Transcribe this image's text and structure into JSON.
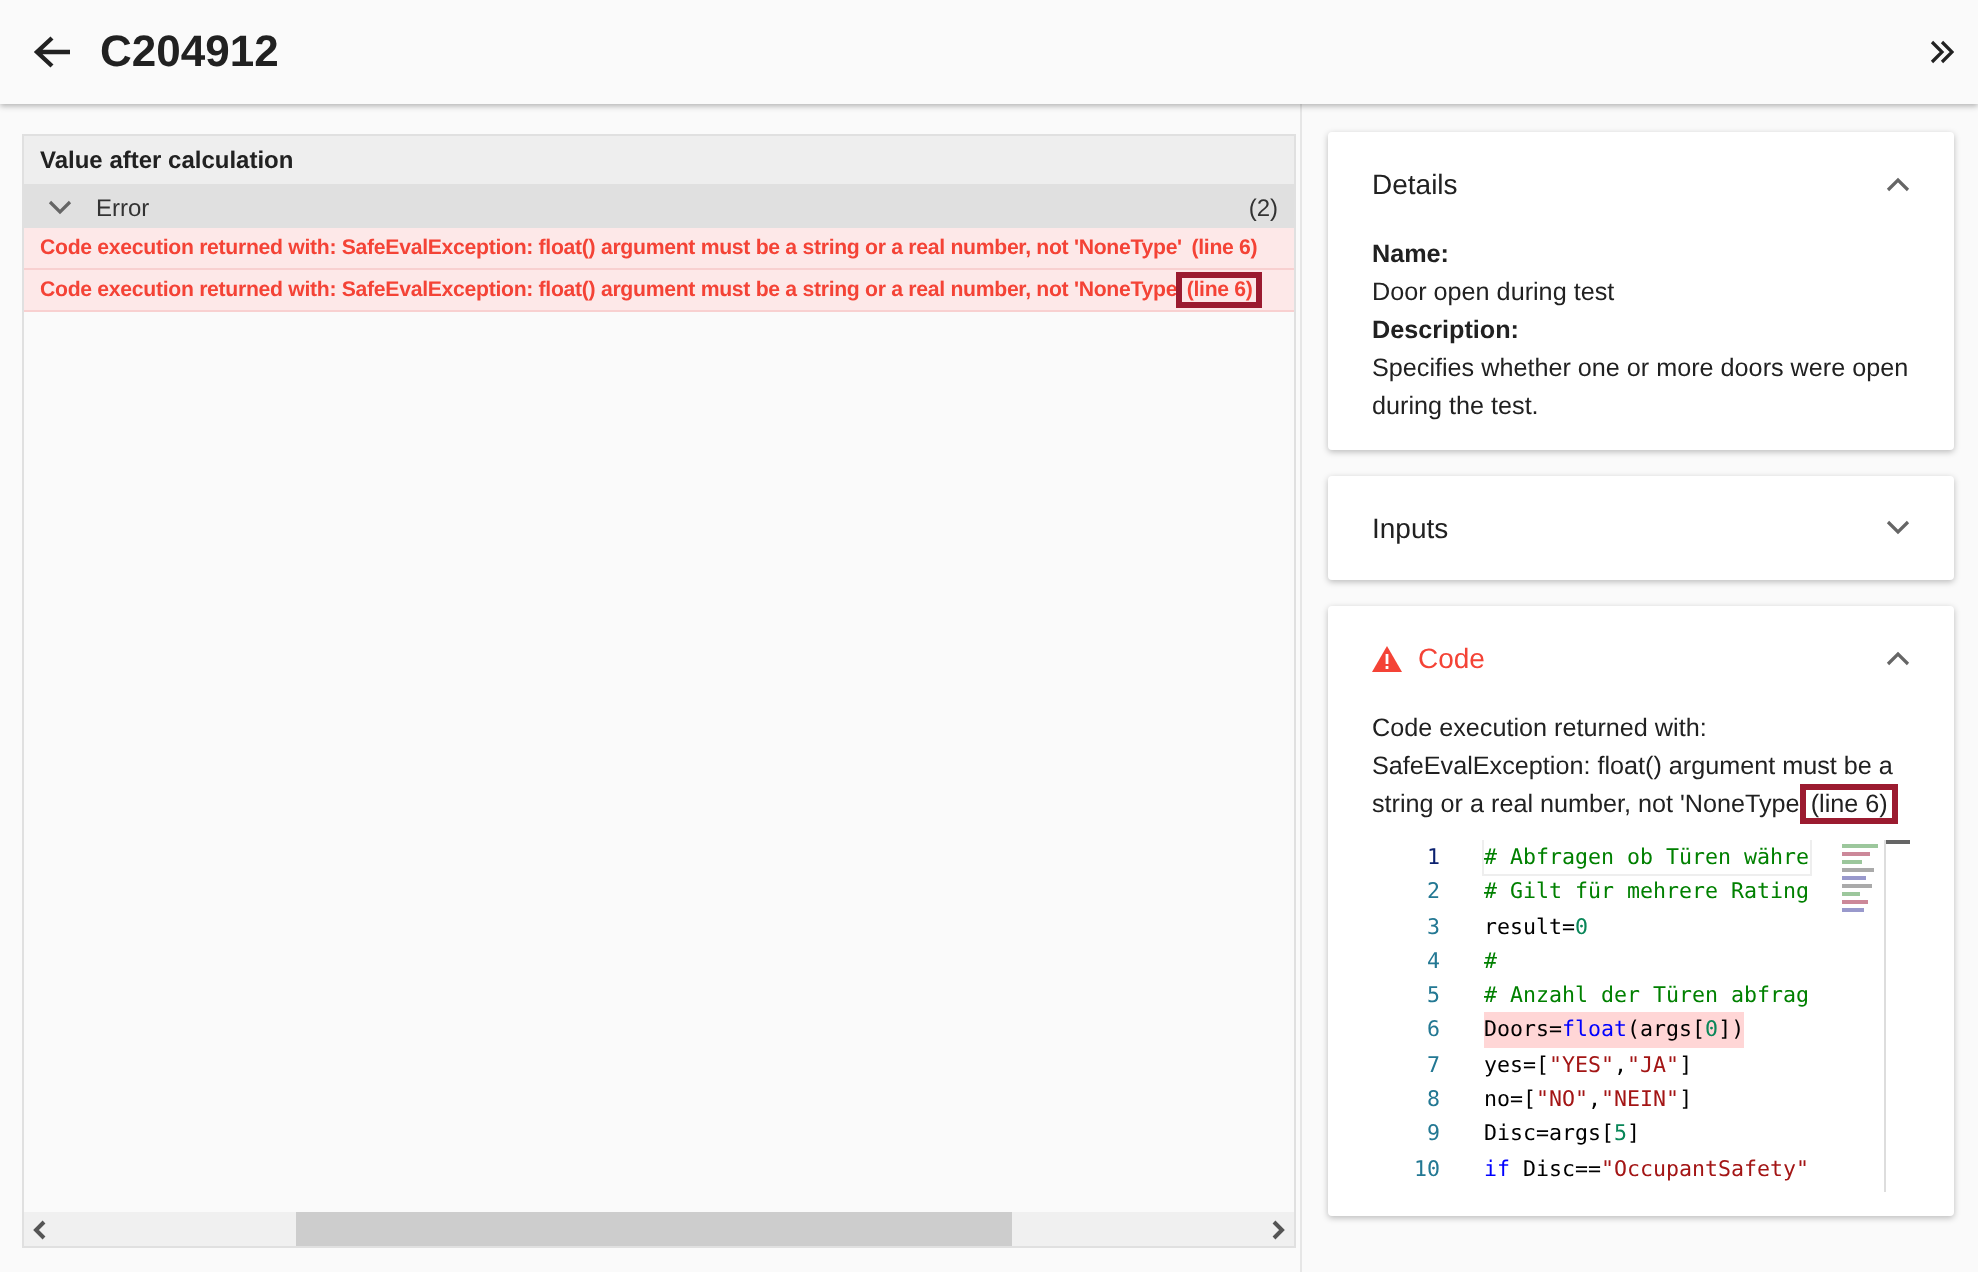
{
  "header": {
    "title": "C204912"
  },
  "result_panel": {
    "title": "Value after calculation",
    "group": {
      "label": "Error",
      "count": "(2)",
      "expanded": true
    },
    "rows": [
      {
        "message": "Code execution returned with: SafeEvalException: float() argument must be a string or a real number, not 'NoneType'",
        "line": "(line 6)",
        "marked": false
      },
      {
        "message": "Code execution returned with: SafeEvalException: float() argument must be a string or a real number, not 'NoneType",
        "line": "(line 6)",
        "marked": true
      }
    ]
  },
  "details": {
    "title": "Details",
    "expanded": true,
    "fields": [
      {
        "label": "Name:",
        "value": "Door open during test"
      },
      {
        "label": "Description:",
        "value": "Specifies whether one or more doors were open during the test."
      }
    ]
  },
  "inputs": {
    "title": "Inputs",
    "expanded": false
  },
  "code": {
    "title": "Code",
    "expanded": true,
    "error": true,
    "message": "Code execution returned with: SafeEvalException: float() argument must be a string or a real number, not 'NoneType",
    "line": "(line 6)",
    "marked": true,
    "lines": [
      {
        "number": "1",
        "current": true,
        "error": false,
        "tokens": [
          {
            "kind": "comment",
            "text": "# Abfragen ob Türen währe"
          }
        ]
      },
      {
        "number": "2",
        "current": false,
        "error": false,
        "tokens": [
          {
            "kind": "comment",
            "text": "# Gilt für mehrere Rating"
          }
        ]
      },
      {
        "number": "3",
        "current": false,
        "error": false,
        "tokens": [
          {
            "kind": "plain",
            "text": "result="
          },
          {
            "kind": "number",
            "text": "0"
          }
        ]
      },
      {
        "number": "4",
        "current": false,
        "error": false,
        "tokens": [
          {
            "kind": "comment",
            "text": "#"
          }
        ]
      },
      {
        "number": "5",
        "current": false,
        "error": false,
        "tokens": [
          {
            "kind": "comment",
            "text": "# Anzahl der Türen abfrag"
          }
        ]
      },
      {
        "number": "6",
        "current": false,
        "error": true,
        "tokens": [
          {
            "kind": "plain",
            "text": "Doors="
          },
          {
            "kind": "keyword",
            "text": "float"
          },
          {
            "kind": "plain",
            "text": "(args["
          },
          {
            "kind": "number",
            "text": "0"
          },
          {
            "kind": "plain",
            "text": "])"
          }
        ]
      },
      {
        "number": "7",
        "current": false,
        "error": false,
        "tokens": [
          {
            "kind": "plain",
            "text": "yes=["
          },
          {
            "kind": "string",
            "text": "\"YES\""
          },
          {
            "kind": "plain",
            "text": ","
          },
          {
            "kind": "string",
            "text": "\"JA\""
          },
          {
            "kind": "plain",
            "text": "]"
          }
        ]
      },
      {
        "number": "8",
        "current": false,
        "error": false,
        "tokens": [
          {
            "kind": "plain",
            "text": "no=["
          },
          {
            "kind": "string",
            "text": "\"NO\""
          },
          {
            "kind": "plain",
            "text": ","
          },
          {
            "kind": "string",
            "text": "\"NEIN\""
          },
          {
            "kind": "plain",
            "text": "]"
          }
        ]
      },
      {
        "number": "9",
        "current": false,
        "error": false,
        "tokens": [
          {
            "kind": "plain",
            "text": "Disc=args["
          },
          {
            "kind": "number",
            "text": "5"
          },
          {
            "kind": "plain",
            "text": "]"
          }
        ]
      },
      {
        "number": "10",
        "current": false,
        "error": false,
        "tokens": [
          {
            "kind": "keyword",
            "text": "if"
          },
          {
            "kind": "plain",
            "text": " Disc=="
          },
          {
            "kind": "string",
            "text": "\"OccupantSafety\""
          }
        ]
      }
    ]
  }
}
